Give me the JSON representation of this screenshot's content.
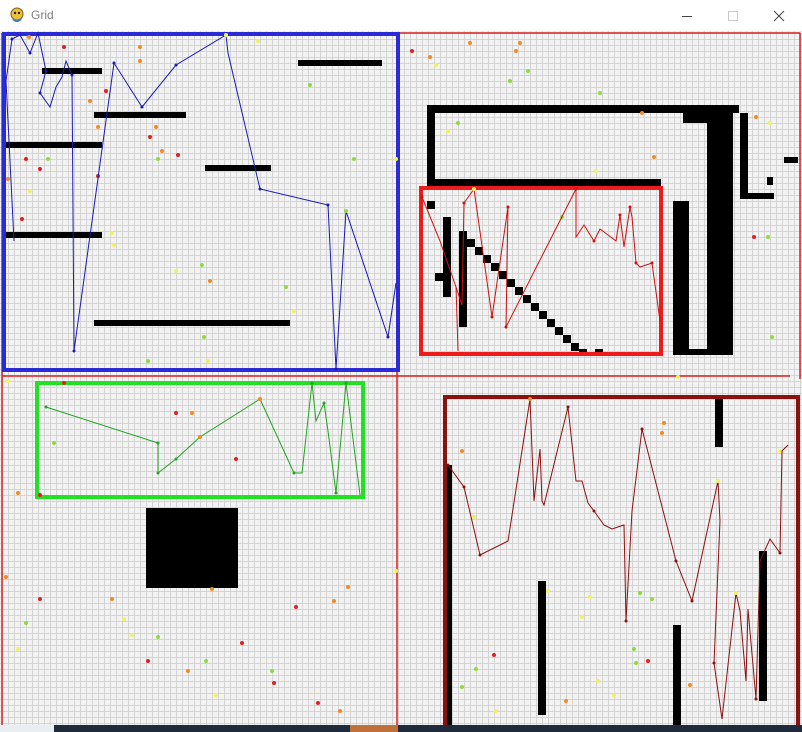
{
  "window": {
    "title": "Grid",
    "controls": [
      "minimize-icon",
      "maximize-icon",
      "close-icon"
    ]
  },
  "colors": {
    "grid_bg": "#f3f3f3",
    "grid_line": "#d4d4d4",
    "quadrant_divider": "#dd2020",
    "wall": "#000000",
    "dot_red": "#e02020",
    "dot_orange": "#f08a24",
    "dot_green": "#8cdc3c",
    "dot_yellow": "#f2f25a",
    "panels": {
      "top_left": "#2b2bd6",
      "top_right_inner": "#ee1b1b",
      "bottom_left": "#22e022",
      "bottom_right": "#8b1010"
    },
    "paths": {
      "top_left": "#1a1ab0",
      "top_right": "#cc1111",
      "bottom_left": "#1fa51f",
      "bottom_right": "#8b1010"
    }
  }
}
